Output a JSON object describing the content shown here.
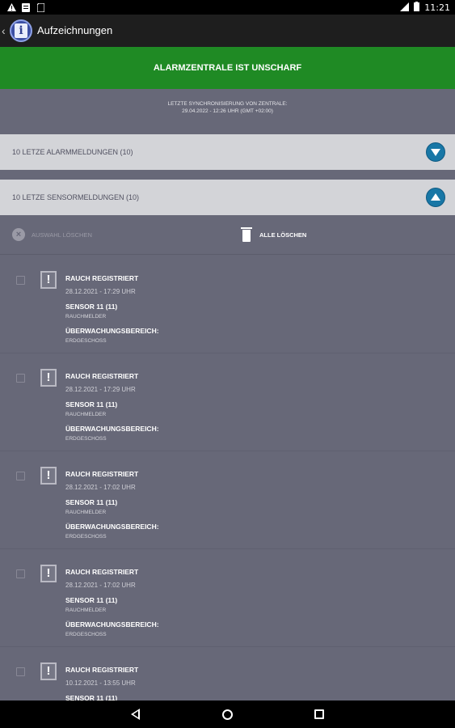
{
  "statusbar": {
    "time": "11:21",
    "icons_left": [
      "warning-icon",
      "message-icon",
      "sim-icon"
    ],
    "icons_right": [
      "signal-icon",
      "battery-icon"
    ]
  },
  "appbar": {
    "title": "Aufzeichnungen",
    "icon": "info-icon"
  },
  "banner": {
    "text": "ALARMZENTRALE IST UNSCHARF",
    "color": "#1f8a24"
  },
  "sync": {
    "line1": "LETZTE SYNCHRONISIERUNG VON ZENTRALE:",
    "line2": "29.04.2022 - 12:26 UHR (GMT +02:00)"
  },
  "sections": [
    {
      "label": "10 LETZE ALARMMELDUNGEN (10)",
      "toggle_icon": "chevron-down-icon"
    },
    {
      "label": "10 LETZE SENSORMELDUNGEN (10)",
      "toggle_icon": "chevron-up-icon"
    }
  ],
  "actions": {
    "clear_selection": "AUSWAHL LÖSCHEN",
    "clear_all": "ALLE LÖSCHEN"
  },
  "entries": [
    {
      "title": "RAUCH REGISTRIERT",
      "datetime": "28.12.2021 - 17:29 UHR",
      "sensor": "SENSOR 11 (11)",
      "sensor_type": "RAUCHMELDER",
      "area_label": "ÜBERWACHUNGSBEREICH:",
      "area": "ERDGESCHOSS"
    },
    {
      "title": "RAUCH REGISTRIERT",
      "datetime": "28.12.2021 - 17:29 UHR",
      "sensor": "SENSOR 11 (11)",
      "sensor_type": "RAUCHMELDER",
      "area_label": "ÜBERWACHUNGSBEREICH:",
      "area": "ERDGESCHOSS"
    },
    {
      "title": "RAUCH REGISTRIERT",
      "datetime": "28.12.2021 - 17:02 UHR",
      "sensor": "SENSOR 11 (11)",
      "sensor_type": "RAUCHMELDER",
      "area_label": "ÜBERWACHUNGSBEREICH:",
      "area": "ERDGESCHOSS"
    },
    {
      "title": "RAUCH REGISTRIERT",
      "datetime": "28.12.2021 - 17:02 UHR",
      "sensor": "SENSOR 11 (11)",
      "sensor_type": "RAUCHMELDER",
      "area_label": "ÜBERWACHUNGSBEREICH:",
      "area": "ERDGESCHOSS"
    },
    {
      "title": "RAUCH REGISTRIERT",
      "datetime": "10.12.2021 - 13:55 UHR",
      "sensor": "SENSOR 11 (11)",
      "sensor_type": "",
      "area_label": "",
      "area": ""
    }
  ],
  "navbar": {
    "icons": [
      "back-icon",
      "home-icon",
      "recents-icon"
    ]
  }
}
